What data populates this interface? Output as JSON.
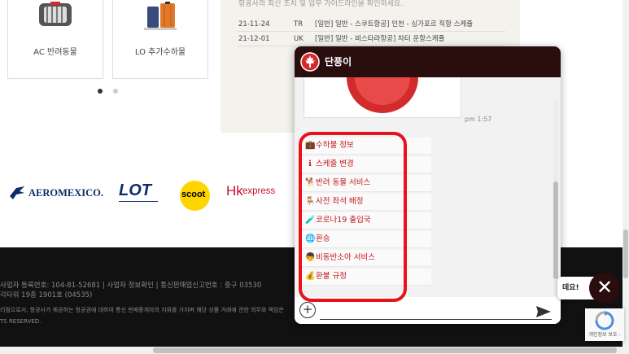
{
  "cards": [
    {
      "label": "AC 반려동물",
      "icon": "pet-carrier-icon"
    },
    {
      "label": "LO 추가수하물",
      "icon": "suitcase-icon"
    }
  ],
  "notice": {
    "intro": "항공사의 최신 조치 및 업무 가이드라인을 확인하세요.",
    "rows": [
      {
        "date": "21-11-24",
        "code": "TR",
        "title": "[일반] 일반 - 스쿠트항공] 인천 - 싱가포르 직항 스케쥴"
      },
      {
        "date": "21-12-01",
        "code": "UK",
        "title": "[일반] 일반 - 비스타라항공] 차터 운항스케쥴"
      }
    ]
  },
  "logos": {
    "aeromexico": "AEROMEXICO.",
    "lot": "LOT",
    "scoot": "scoot",
    "hk_mark": "Hk",
    "hk_express": "express"
  },
  "footer": {
    "line1": "사업자 등록번호: 104-81-52681  |  사업자 정보확인  |  통신판매업신고번호 : 중구 03530",
    "line2": "각타워 19층 1901호 (04535)",
    "line3": "리점으로서, 항공사가 제공하는 항공권에 대하여 통신 판매중개자의 지위를 가지며 해당 상품 거래에 관한 의무와 책임은",
    "line4": "TS RESERVED."
  },
  "chat": {
    "title": "단풍이",
    "time_1": "pm 1:57",
    "menu": [
      {
        "emoji": "💼",
        "label": "수하물 정보",
        "icon": "briefcase-icon"
      },
      {
        "emoji": "ℹ",
        "label": "스케줄 변경",
        "icon": "info-icon"
      },
      {
        "emoji": "🐕",
        "label": "반려 동물 서비스",
        "icon": "dog-icon"
      },
      {
        "emoji": "🪑",
        "label": "사전 좌석 배정",
        "icon": "seat-icon"
      },
      {
        "emoji": "🧪",
        "label": "코로나19 출입국",
        "icon": "test-tube-icon"
      },
      {
        "emoji": "🌐",
        "label": "환승",
        "icon": "globe-icon"
      },
      {
        "emoji": "👦",
        "label": "비동반소아 서비스",
        "icon": "child-icon"
      },
      {
        "emoji": "💰",
        "label": "환불 규정",
        "icon": "money-bag-icon"
      }
    ],
    "plus": "+"
  },
  "tip": {
    "text": "데요!"
  },
  "close": {
    "label": "✕"
  },
  "recaptcha": {
    "text": "개인정보 보호 -"
  },
  "colors": {
    "brand_dark": "#2a0d0d",
    "brand_red": "#d32b2b",
    "menu_text": "#c2161c",
    "highlight": "#e8121c"
  }
}
